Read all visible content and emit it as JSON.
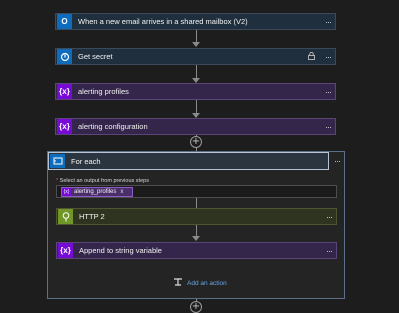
{
  "steps": [
    {
      "label": "When a new email arrives in a shared mailbox (V2)",
      "icon": "outlook-icon"
    },
    {
      "label": "Get secret",
      "icon": "key-vault-icon"
    },
    {
      "label": "alerting profiles",
      "icon": "variable-icon"
    },
    {
      "label": "alerting configuration",
      "icon": "variable-icon"
    }
  ],
  "foreach": {
    "title": "For each",
    "select_label": "Select an output from previous steps",
    "required_marker": "*",
    "token": "alerting_profiles",
    "token_remove": "x",
    "inner_steps": [
      {
        "label": "HTTP 2",
        "icon": "http-icon"
      },
      {
        "label": "Append to string variable",
        "icon": "variable-icon"
      }
    ],
    "add_action": "Add an action"
  },
  "glyphs": {
    "more": "···",
    "plus": "+",
    "variable": "{x}"
  },
  "colors": {
    "accent_blue": "#0f6cbd",
    "variable_purple": "#770bd6",
    "http_green": "#709727"
  }
}
